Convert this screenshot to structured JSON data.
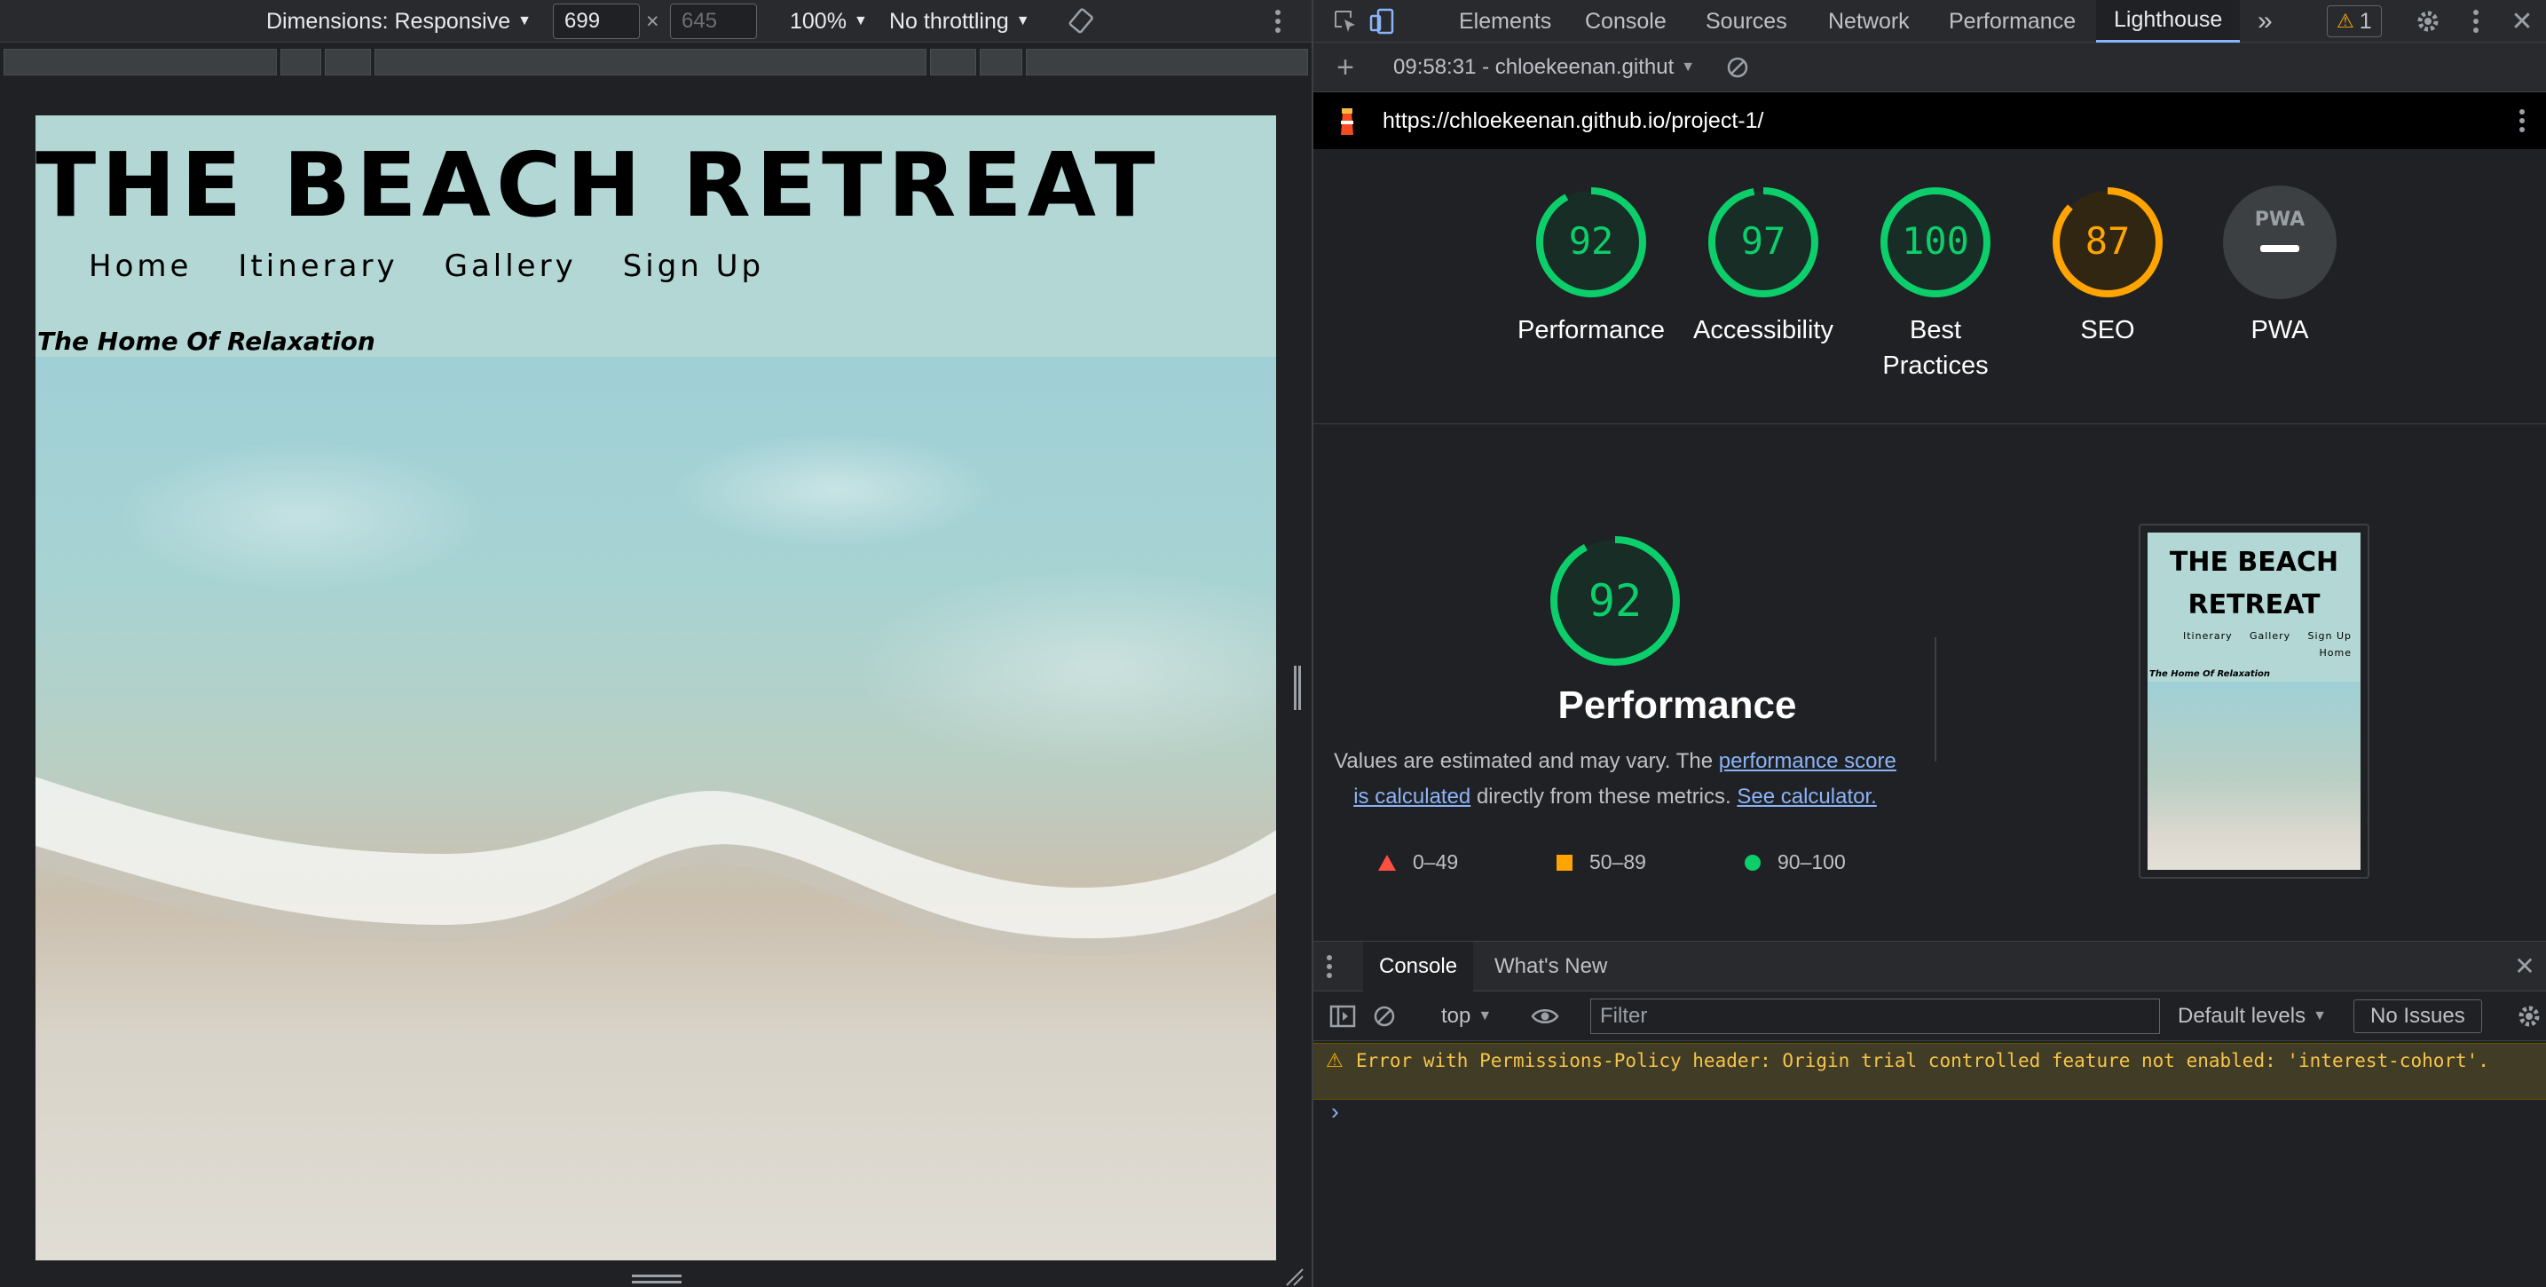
{
  "device_toolbar": {
    "dimensions_label": "Dimensions: Responsive",
    "width": "699",
    "height_placeholder": "645",
    "times_sign": "×",
    "zoom": "100%",
    "throttling": "No throttling"
  },
  "site": {
    "title": "THE BEACH RETREAT",
    "nav": [
      "Home",
      "Itinerary",
      "Gallery",
      "Sign Up"
    ],
    "tagline": "The Home Of Relaxation"
  },
  "devtools": {
    "tabs": [
      "Elements",
      "Console",
      "Sources",
      "Network",
      "Performance",
      "Lighthouse"
    ],
    "more_tabs": "»",
    "warning_count": "1",
    "report_selector": "09:58:31 - chloekeenan.githut",
    "url": "https://chloekeenan.github.io/project-1/"
  },
  "scores": [
    {
      "label": "Performance",
      "value": "92",
      "percent": 92,
      "color": "#0cce6b"
    },
    {
      "label": "Accessibility",
      "value": "97",
      "percent": 97,
      "color": "#0cce6b"
    },
    {
      "label": "Best Practices",
      "value": "100",
      "percent": 100,
      "color": "#0cce6b"
    },
    {
      "label": "SEO",
      "value": "87",
      "percent": 87,
      "color": "#ffa400"
    },
    {
      "label": "PWA",
      "value": "PWA",
      "percent": 0,
      "color": "#9aa0a6"
    }
  ],
  "perf_detail": {
    "score": "92",
    "title": "Performance",
    "desc_prefix": "Values are estimated and may vary. The ",
    "desc_link1": "performance score is calculated",
    "desc_middle": " directly from these metrics. ",
    "desc_link2": "See calculator.",
    "legend": [
      {
        "range": "0–49",
        "color": "#ff4e42",
        "shape": "triangle"
      },
      {
        "range": "50–89",
        "color": "#ffa400",
        "shape": "square"
      },
      {
        "range": "90–100",
        "color": "#0cce6b",
        "shape": "circle"
      }
    ]
  },
  "thumbnail": {
    "title_line1": "THE BEACH",
    "title_line2": "RETREAT",
    "nav": [
      "Itinerary",
      "Gallery",
      "Sign Up",
      "Home"
    ],
    "tagline": "The Home Of Relaxation"
  },
  "drawer": {
    "tabs": [
      "Console",
      "What's New"
    ],
    "context": "top",
    "filter_placeholder": "Filter",
    "levels": "Default levels",
    "issues": "No Issues",
    "warning_message": "Error with Permissions-Policy header: Origin trial controlled feature not enabled: 'interest-cohort'.",
    "prompt": "›"
  },
  "colors": {
    "accent": "#8ab4f8",
    "pass": "#0cce6b",
    "average": "#ffa400",
    "fail": "#ff4e42",
    "site_header_bg": "#b2d7d4"
  }
}
